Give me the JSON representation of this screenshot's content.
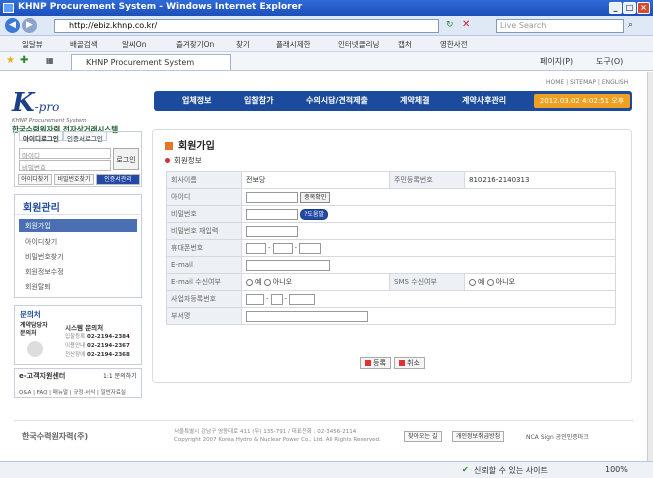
{
  "window": {
    "title": "KHNP Procurement System - Windows Internet Explorer"
  },
  "address": {
    "url": "http://ebiz.khnp.co.kr/",
    "search_placeholder": "Live Search"
  },
  "links_bar": [
    "일달뷰",
    "배골검색",
    "알씨On",
    "즐겨찾기On",
    "찾기",
    "플래시제한",
    "인터넷클리닝",
    "캡처",
    "영한사전"
  ],
  "tab": {
    "label": "KHNP Procurement System",
    "page_menu": "페이지(P)",
    "tools_menu": "도구(O)"
  },
  "site": {
    "top_links": [
      "HOME",
      "SITEMAP",
      "ENGLISH"
    ],
    "logo_k": "K",
    "logo_pro": "-pro",
    "logo_sub": "KHNP Procurement System",
    "logo_kr": "한국수력원자력 전자상거래시스템",
    "gnb": [
      "업체정보",
      "입찰참가",
      "수의시담/견적제출",
      "계약체결",
      "계약사후관리"
    ],
    "clock": "2012.03.02 4:02:51 오후"
  },
  "login": {
    "tab_id": "아이디로그인",
    "tab_cert": "인증서로그인",
    "id_placeholder": "아이디",
    "pw_placeholder": "비밀번호",
    "login_btn": "로그인",
    "find_id": "아이디찾기",
    "find_pw": "비밀번호찾기",
    "cert_login": "인증서관리"
  },
  "sidemenu": {
    "title": "회원관리",
    "items": [
      "회원가입",
      "아이디찾기",
      "비밀번호찾기",
      "회원정보수정",
      "회원탈퇴"
    ]
  },
  "inquiry": {
    "title": "문의처",
    "contract_label": "계약담당자 문의처",
    "system_label": "시스템 문의처",
    "rows": [
      {
        "label": "입찰등록",
        "phone": "02-2194-2384"
      },
      {
        "label": "이용안내",
        "phone": "02-2194-2367"
      },
      {
        "label": "전산장애",
        "phone": "02-2194-2368"
      }
    ]
  },
  "ecenter": {
    "title": "e-고객지원센터",
    "inquiry": "1:1 문의하기",
    "links": [
      "Q&A",
      "FAQ",
      "매뉴얼",
      "규정·서식",
      "일반자료실"
    ]
  },
  "main": {
    "title": "회원가입",
    "section": "회원정보",
    "rows": {
      "company_label": "회사이름",
      "company_value": "전보당",
      "reg_label": "주민등록번호",
      "reg_value": "810216-2140313",
      "id_label": "아이디",
      "dup_btn": "중복확인",
      "pw_label": "비밀번호",
      "pw_help": "?도움말",
      "pw2_label": "비밀번호 재입력",
      "mobile_label": "휴대폰번호",
      "email_label": "E-mail",
      "email_recv_label": "E-mail 수신여부",
      "sms_recv_label": "SMS 수신여부",
      "yes": "예",
      "no": "아니오",
      "bizno_label": "사업자등록번호",
      "dept_label": "부서명"
    },
    "register_btn": "등록",
    "cancel_btn": "취소"
  },
  "footer": {
    "logo": "한국수력원자력(주)",
    "address": "서울특별시 강남구 영동대로 411  (우) 135-791 / 대표전화 : 02-3456-2114",
    "copyright": "Copyright 2007 Korea Hydro & Nuclear Power Co., Ltd. All Rights Reserved.",
    "btn1": "찾아오는 길",
    "btn2": "개인정보취급방침",
    "nca": "NCA Sign 공인인증마크"
  },
  "status": {
    "zone": "신뢰할 수 있는 사이트",
    "zoom": "100%"
  }
}
